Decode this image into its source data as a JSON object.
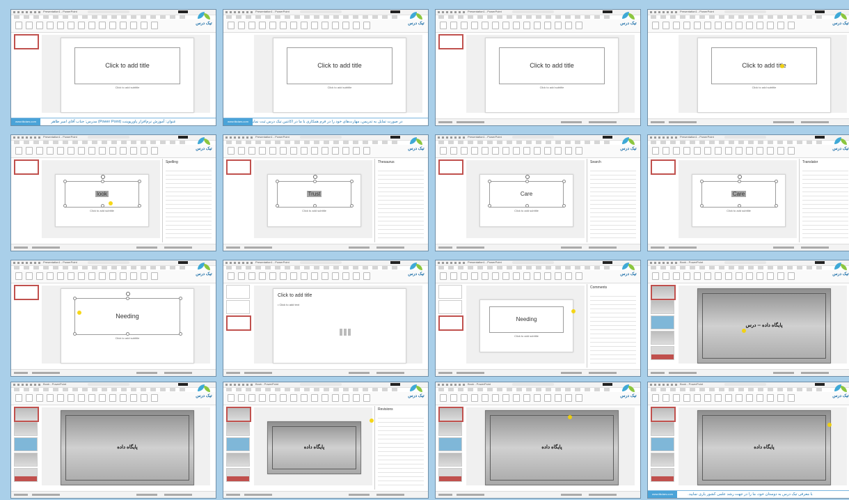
{
  "brand": {
    "logo_text": "تیک درس",
    "accent": "#1f78b4",
    "logo_leaf_colors": [
      "#3fa9d6",
      "#8cc63f"
    ]
  },
  "thumbnails": [
    {
      "id": "t1",
      "app_title": "Presentation1 - PowerPoint",
      "slide_title": "Click to add title",
      "slide_subtitle": "Click to add subtitle",
      "caption": "عنوان: آموزش نرم‌افزار پاورپوینت (Power Point)     مدرس: جناب آقای امیر طاهر",
      "caption_tag": "www.tikdars.com"
    },
    {
      "id": "t2",
      "app_title": "Presentation1 - PowerPoint",
      "slide_title": "Click to add title",
      "slide_subtitle": "Click to add subtitle",
      "caption": "در صورت تمایل به تدریس، مهارت‌های خود را در فرم همکاری با ما در اکانتین تیک درس ثبت نمایید.",
      "caption_tag": "www.tikdars.com"
    },
    {
      "id": "t3",
      "app_title": "Presentation1 - PowerPoint",
      "slide_title": "Click to add title",
      "slide_subtitle": "Click to add subtitle"
    },
    {
      "id": "t4",
      "app_title": "Presentation1 - PowerPoint",
      "slide_title": "Click to add title",
      "slide_subtitle": "Click to add subtitle"
    },
    {
      "id": "t5",
      "app_title": "Presentation1 - PowerPoint",
      "slide_title": "look",
      "slide_subtitle": "Click to add subtitle",
      "pane_title": "Spelling"
    },
    {
      "id": "t6",
      "app_title": "Presentation1 - PowerPoint",
      "slide_title": "Trust",
      "slide_subtitle": "Click to add subtitle",
      "pane_title": "Thesaurus"
    },
    {
      "id": "t7",
      "app_title": "Presentation1 - PowerPoint",
      "slide_title": "Care",
      "slide_subtitle": "Click to add subtitle",
      "pane_title": "Search"
    },
    {
      "id": "t8",
      "app_title": "Presentation1 - PowerPoint",
      "slide_title": "Care",
      "slide_subtitle": "Click to add subtitle",
      "pane_title": "Translator"
    },
    {
      "id": "t9",
      "app_title": "Presentation1 - PowerPoint",
      "slide_title": "Needing",
      "slide_subtitle": "Click to add subtitle"
    },
    {
      "id": "t10",
      "app_title": "Presentation1 - PowerPoint",
      "slide_title": "Click to add title",
      "slide_subtitle": "• Click to add text"
    },
    {
      "id": "t11",
      "app_title": "Presentation1 - PowerPoint",
      "slide_title": "Needing",
      "slide_subtitle": "Click to add subtitle",
      "pane_title": "Comments"
    },
    {
      "id": "t12",
      "app_title": "Book - PowerPoint",
      "slide_title": "پایگاه داده -- درس"
    },
    {
      "id": "t13",
      "app_title": "Book - PowerPoint",
      "slide_title": "پایگاه داده"
    },
    {
      "id": "t14",
      "app_title": "Book - PowerPoint",
      "slide_title": "پایگاه داده",
      "pane_title": "Revisions"
    },
    {
      "id": "t15",
      "app_title": "Book - PowerPoint",
      "slide_title": "پایگاه داده"
    },
    {
      "id": "t16",
      "app_title": "Book - PowerPoint",
      "slide_title": "پایگاه داده",
      "caption": "با معرفی تیک درس به دوستان خود، ما را در جهت رشد علمی کشور یاری نمایید.",
      "caption_tag": "www.tikdars.com"
    }
  ]
}
